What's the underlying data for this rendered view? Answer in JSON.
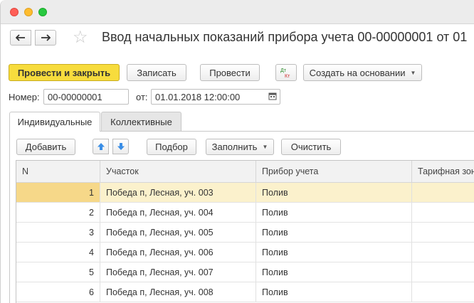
{
  "window": {
    "title": ""
  },
  "toolbar": {
    "back_label": "🡐",
    "forward_label": "🡒",
    "title": "Ввод начальных показаний прибора учета 00-00000001 от 01"
  },
  "actions": {
    "post_and_close": "Провести и закрыть",
    "save": "Записать",
    "post": "Провести",
    "dt_kt": "Дт Кт",
    "create_based_on": "Создать на основании"
  },
  "header_fields": {
    "number_label": "Номер:",
    "number_value": "00-00000001",
    "date_label": "от:",
    "date_value": "01.01.2018 12:00:00"
  },
  "tabs": [
    {
      "label": "Индивидуальные",
      "active": true
    },
    {
      "label": "Коллективные",
      "active": false
    }
  ],
  "table_toolbar": {
    "add": "Добавить",
    "selection": "Подбор",
    "fill": "Заполнить",
    "clear": "Очистить"
  },
  "table": {
    "columns": [
      "N",
      "Участок",
      "Прибор учета",
      "Тарифная зона"
    ],
    "rows": [
      {
        "n": "1",
        "area": "Победа п, Лесная, уч. 003",
        "device": "Полив",
        "zone": ""
      },
      {
        "n": "2",
        "area": "Победа п, Лесная, уч. 004",
        "device": "Полив",
        "zone": ""
      },
      {
        "n": "3",
        "area": "Победа п, Лесная, уч. 005",
        "device": "Полив",
        "zone": ""
      },
      {
        "n": "4",
        "area": "Победа п, Лесная, уч. 006",
        "device": "Полив",
        "zone": ""
      },
      {
        "n": "5",
        "area": "Победа п, Лесная, уч. 007",
        "device": "Полив",
        "zone": ""
      },
      {
        "n": "6",
        "area": "Победа п, Лесная, уч. 008",
        "device": "Полив",
        "zone": ""
      }
    ],
    "selected_row": 0
  },
  "colors": {
    "primary_button": "#f7dc3d",
    "selected_row": "#fbf1cc",
    "selected_cell": "#f6d889",
    "arrow_blue": "#3a8ee6"
  },
  "icons": [
    "back-arrow-icon",
    "forward-arrow-icon",
    "favorite-star-icon",
    "dt-kt-icon",
    "calendar-icon",
    "move-up-icon",
    "move-down-icon",
    "dropdown-caret-icon"
  ]
}
